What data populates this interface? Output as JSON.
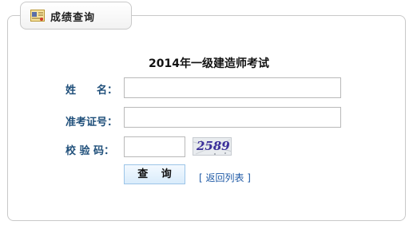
{
  "tab": {
    "icon": "certificate-icon",
    "title": "成绩查询"
  },
  "form": {
    "exam_title": "2014年一级建造师考试",
    "name_label": "姓　　名：",
    "name_value": "",
    "cert_label": "准考证号：",
    "cert_value": "",
    "captcha_label": "校 验 码：",
    "captcha_value": "",
    "captcha_image_text": "2589",
    "query_button": "查 询",
    "back_link": "[ 返回列表 ]"
  },
  "colors": {
    "label": "#1f4f7a",
    "link": "#1f5aa6",
    "captcha_text": "#3b2f9a",
    "button_bg": "#d9ecfb"
  }
}
